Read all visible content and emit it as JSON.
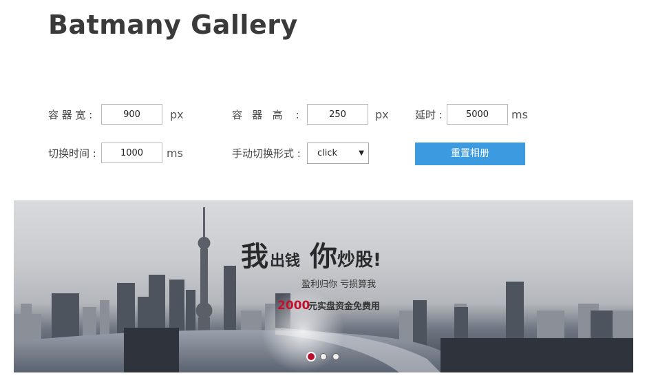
{
  "header": {
    "title": "Batmany Gallery"
  },
  "settings": {
    "width_label": "容 器 宽 :",
    "width_value": "900",
    "width_unit": "px",
    "height_label": "容   器   高    :",
    "height_value": "250",
    "height_unit": "px",
    "delay_label": "延时 :",
    "delay_value": "5000",
    "delay_unit": "ms",
    "switch_time_label": "切换时间 :",
    "switch_time_value": "1000",
    "switch_time_unit": "ms",
    "manual_mode_label": "手动切换形式 :",
    "manual_mode_value": "click",
    "reset_button_label": "重置相册"
  },
  "slide": {
    "headline_part1": "我",
    "headline_part2": "出钱",
    "headline_part3": "你",
    "headline_part4": "炒股!",
    "subline": "盈利归你 亏损算我",
    "offer_number": "2000",
    "offer_text": "元实盘资金免费用"
  },
  "pagination": {
    "count": 3,
    "active_index": 0
  },
  "colors": {
    "button": "#3c9be0",
    "active_dot": "#b8102e",
    "offer": "#c4102a"
  }
}
